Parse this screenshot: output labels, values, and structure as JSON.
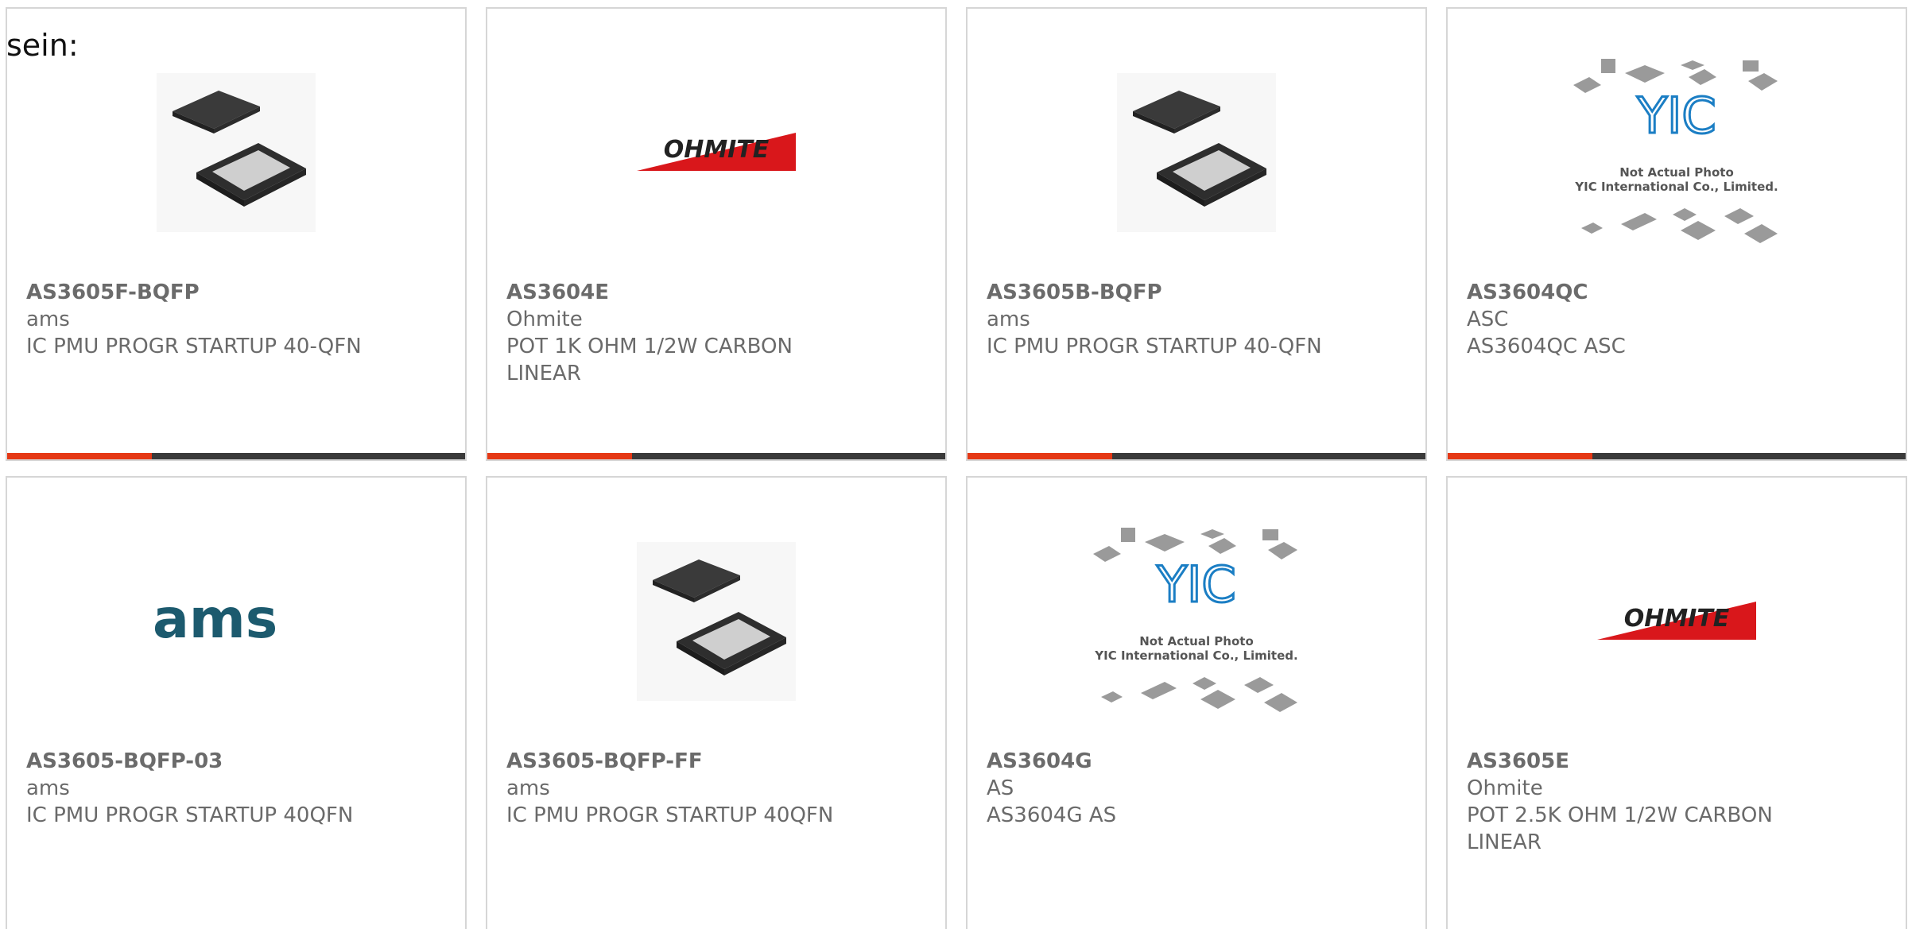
{
  "intro_text": "sein:",
  "colors": {
    "accent": "#e53815",
    "bar": "#3a3a3a",
    "ams_logo": "#1c5a6e",
    "ohmite_red": "#d9171b",
    "yic_blue": "#1b7ec4"
  },
  "products": [
    {
      "part": "AS3605F-BQFP",
      "manufacturer": "ams",
      "description": "IC PMU PROGR STARTUP 40-QFN",
      "image": "qfn-chip"
    },
    {
      "part": "AS3604E",
      "manufacturer": "Ohmite",
      "description": "POT 1K OHM 1/2W CARBON LINEAR",
      "image": "ohmite-logo"
    },
    {
      "part": "AS3605B-BQFP",
      "manufacturer": "ams",
      "description": "IC PMU PROGR STARTUP 40-QFN",
      "image": "qfn-chip"
    },
    {
      "part": "AS3604QC",
      "manufacturer": "ASC",
      "description": "AS3604QC ASC",
      "image": "yic-placeholder"
    },
    {
      "part": "AS3605-BQFP-03",
      "manufacturer": "ams",
      "description": "IC PMU PROGR STARTUP 40QFN",
      "image": "ams-logo"
    },
    {
      "part": "AS3605-BQFP-FF",
      "manufacturer": "ams",
      "description": "IC PMU PROGR STARTUP 40QFN",
      "image": "qfn-chip"
    },
    {
      "part": "AS3604G",
      "manufacturer": "AS",
      "description": "AS3604G AS",
      "image": "yic-placeholder"
    },
    {
      "part": "AS3605E",
      "manufacturer": "Ohmite",
      "description": "POT 2.5K OHM 1/2W CARBON LINEAR",
      "image": "ohmite-logo"
    }
  ],
  "logos": {
    "ohmite": "OHMITE",
    "ams": "ams",
    "yic_line1": "Not Actual Photo",
    "yic_line2": "YIC International Co., Limited."
  }
}
